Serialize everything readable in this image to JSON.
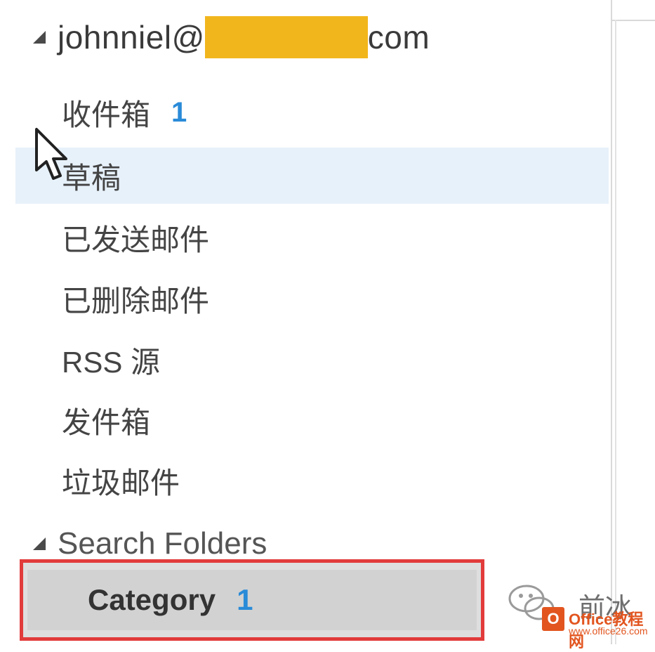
{
  "account": {
    "prefix": "johnniel@",
    "suffix": "com"
  },
  "folders": [
    {
      "label": "收件箱",
      "count": "1"
    },
    {
      "label": "草稿",
      "count": ""
    },
    {
      "label": "已发送邮件",
      "count": ""
    },
    {
      "label": "已删除邮件",
      "count": ""
    },
    {
      "label": "RSS 源",
      "count": ""
    },
    {
      "label": "发件箱",
      "count": ""
    },
    {
      "label": "垃圾邮件",
      "count": ""
    }
  ],
  "search_folders": {
    "label": "Search Folders",
    "items": [
      {
        "label": "Category",
        "count": "1"
      }
    ]
  },
  "watermark": {
    "overlay_text": "前冰",
    "brand": "Office教程网",
    "url": "www.office26.com"
  },
  "colors": {
    "redaction": "#f2b61d",
    "highlight_border": "#e23b3b",
    "count_blue": "#2a8bd8",
    "hover_bg": "#e7f1fa"
  }
}
